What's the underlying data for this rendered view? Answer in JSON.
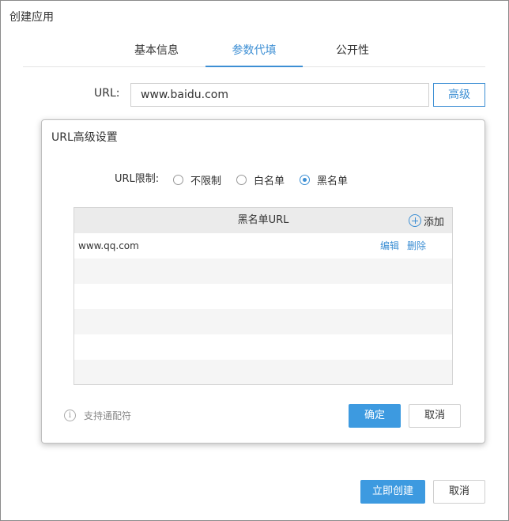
{
  "window": {
    "title": "创建应用"
  },
  "tabs": [
    {
      "label": "基本信息",
      "active": false
    },
    {
      "label": "参数代填",
      "active": true
    },
    {
      "label": "公开性",
      "active": false
    }
  ],
  "url_field": {
    "label": "URL:",
    "value": "www.baidu.com",
    "advanced_label": "高级"
  },
  "dialog": {
    "title": "URL高级设置",
    "limit_label": "URL限制:",
    "options": [
      {
        "label": "不限制",
        "selected": false
      },
      {
        "label": "白名单",
        "selected": false
      },
      {
        "label": "黑名单",
        "selected": true
      }
    ],
    "table": {
      "header": "黑名单URL",
      "add_label": "添加",
      "rows": [
        {
          "url": "www.qq.com",
          "edit": "编辑",
          "delete": "删除"
        }
      ]
    },
    "hint": "支持通配符",
    "confirm_label": "确定",
    "cancel_label": "取消"
  },
  "footer": {
    "create_label": "立即创建",
    "cancel_label": "取消"
  },
  "colors": {
    "accent": "#3d8fd4",
    "primary_button": "#3d9ae0",
    "table_header": "#ebebeb",
    "row_alt": "#f5f5f5"
  }
}
